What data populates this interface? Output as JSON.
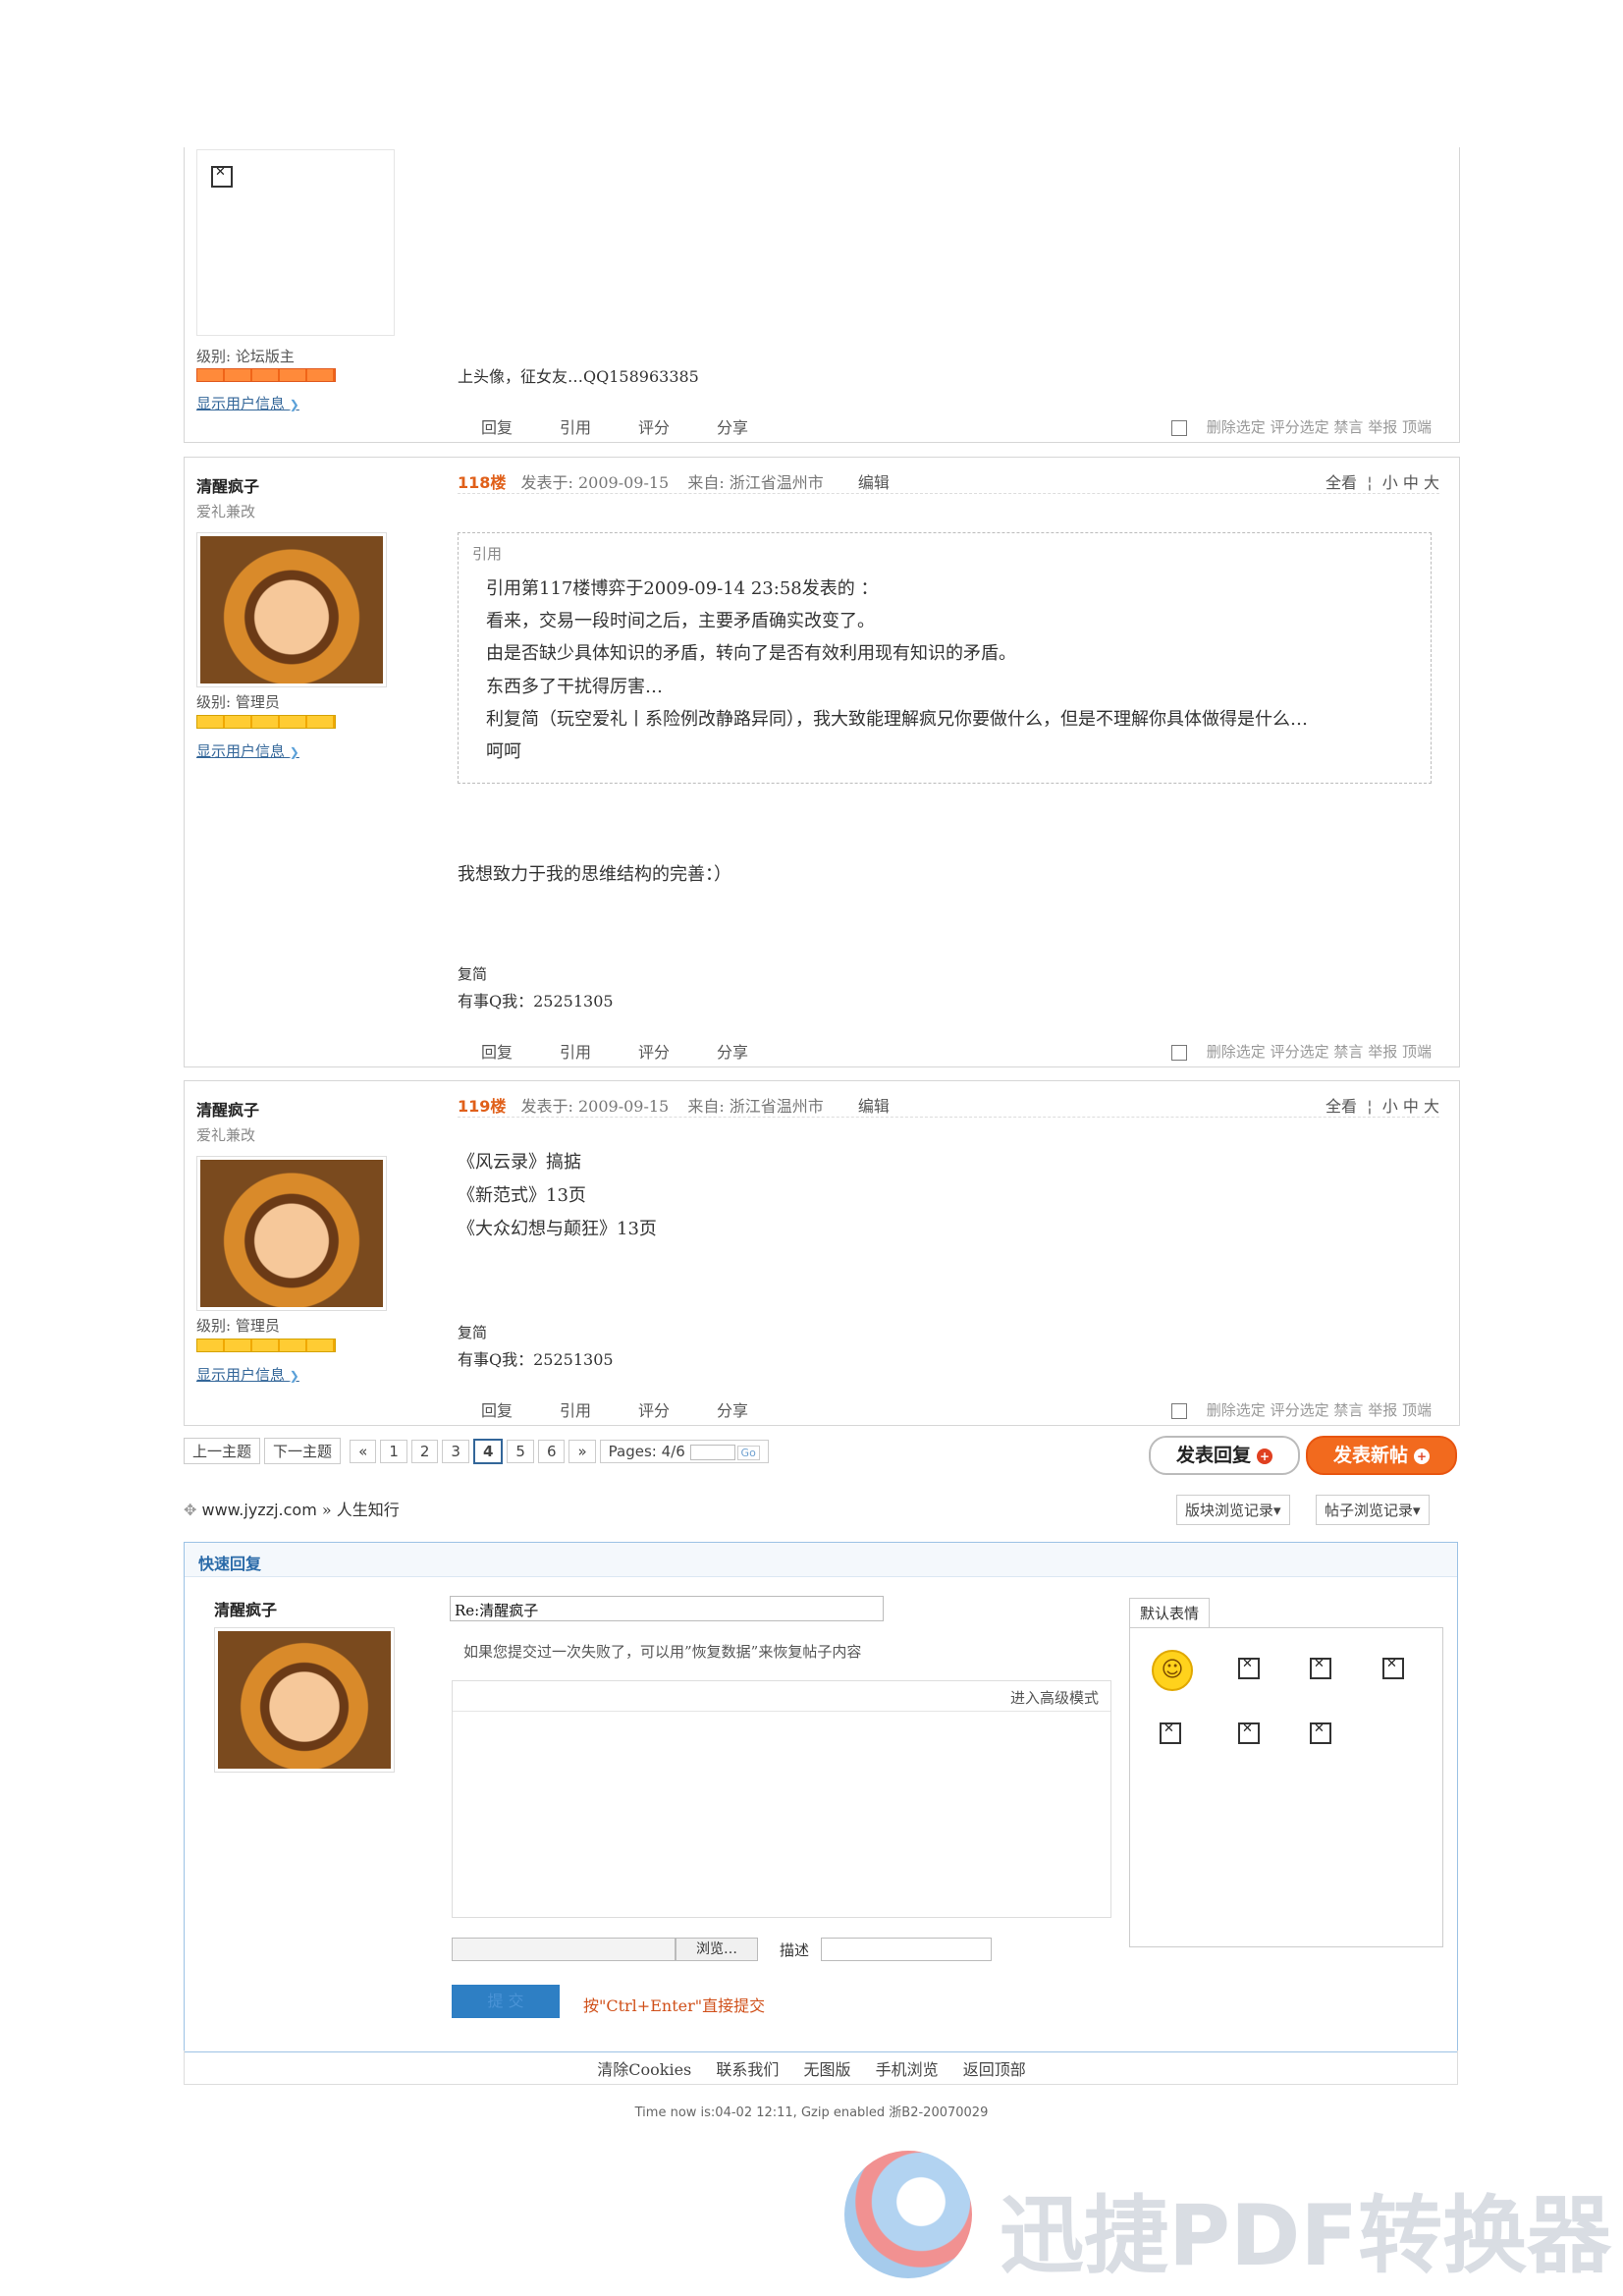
{
  "post_top": {
    "level": "级别: 论坛版主",
    "show_info": "显示用户信息",
    "signature": "上头像，征女友…QQ158963385",
    "actions": [
      "回复",
      "引用",
      "评分",
      "分享"
    ],
    "admin": [
      "删除选定",
      "评分选定",
      "禁言",
      "举报",
      "顶端"
    ]
  },
  "post_118": {
    "username": "清醒疯子",
    "user_title": "爱礼兼改",
    "level": "级别: 管理员",
    "show_info": "显示用户信息",
    "floor": "118楼",
    "posted": "发表于: 2009-09-15",
    "from": "来自: 浙江省温州市",
    "edit": "编辑",
    "view_all": "全看",
    "size_options": [
      "小",
      "中",
      "大"
    ],
    "quote_label": "引用",
    "quote_lines": [
      "引用第117楼博弈于2009-09-14 23:58发表的 ：",
      "看来，交易一段时间之后，主要矛盾确实改变了。",
      "由是否缺少具体知识的矛盾，转向了是否有效利用现有知识的矛盾。",
      "东西多了干扰得厉害…",
      "利复简（玩空爱礼丨系险例改静路异同），我大致能理解疯兄你要做什么，但是不理解你具体做得是什么…",
      "呵呵"
    ],
    "body": "我想致力于我的思维结构的完善：）",
    "sig1": "复简",
    "sig2": "有事Q我：25251305",
    "actions": [
      "回复",
      "引用",
      "评分",
      "分享"
    ],
    "admin": [
      "删除选定",
      "评分选定",
      "禁言",
      "举报",
      "顶端"
    ]
  },
  "post_119": {
    "username": "清醒疯子",
    "user_title": "爱礼兼改",
    "level": "级别: 管理员",
    "show_info": "显示用户信息",
    "floor": "119楼",
    "posted": "发表于: 2009-09-15",
    "from": "来自: 浙江省温州市",
    "edit": "编辑",
    "view_all": "全看",
    "size_options": [
      "小",
      "中",
      "大"
    ],
    "body_lines": [
      "《风云录》搞掂",
      "《新范式》13页",
      "《大众幻想与颠狂》13页"
    ],
    "sig1": "复简",
    "sig2": "有事Q我：25251305",
    "actions": [
      "回复",
      "引用",
      "评分",
      "分享"
    ],
    "admin": [
      "删除选定",
      "评分选定",
      "禁言",
      "举报",
      "顶端"
    ]
  },
  "pager": {
    "prev_topic": "上一主题",
    "next_topic": "下一主题",
    "first": "«",
    "pages": [
      "1",
      "2",
      "3",
      "4",
      "5",
      "6"
    ],
    "current": "4",
    "last": "»",
    "pages_label": "Pages: 4/6",
    "go": "Go"
  },
  "buttons": {
    "reply": "发表回复",
    "new_topic": "发表新帖"
  },
  "breadcrumb": {
    "site": "www.jyzzj.com",
    "sep": "»",
    "forum": "人生知行"
  },
  "history": {
    "board": "版块浏览记录▾",
    "thread": "帖子浏览记录▾"
  },
  "quick_reply": {
    "title": "快速回复",
    "username": "清醒疯子",
    "subject_value": "Re:清醒疯子",
    "hint": "如果您提交过一次失败了，可以用”恢复数据”来恢复帖子内容",
    "advanced": "进入高级模式",
    "browse": "浏览…",
    "desc_label": "描述",
    "submit": "提 交",
    "ctrl_enter": "按\"Ctrl+Enter\"直接提交",
    "smiley_tab": "默认表情"
  },
  "footer": {
    "links": [
      "清除Cookies",
      "联系我们",
      "无图版",
      "手机浏览",
      "返回顶部"
    ],
    "time": "Time now is:04-02 12:11, Gzip enabled 浙B2-20070029"
  },
  "watermark": "迅捷PDF转换器"
}
